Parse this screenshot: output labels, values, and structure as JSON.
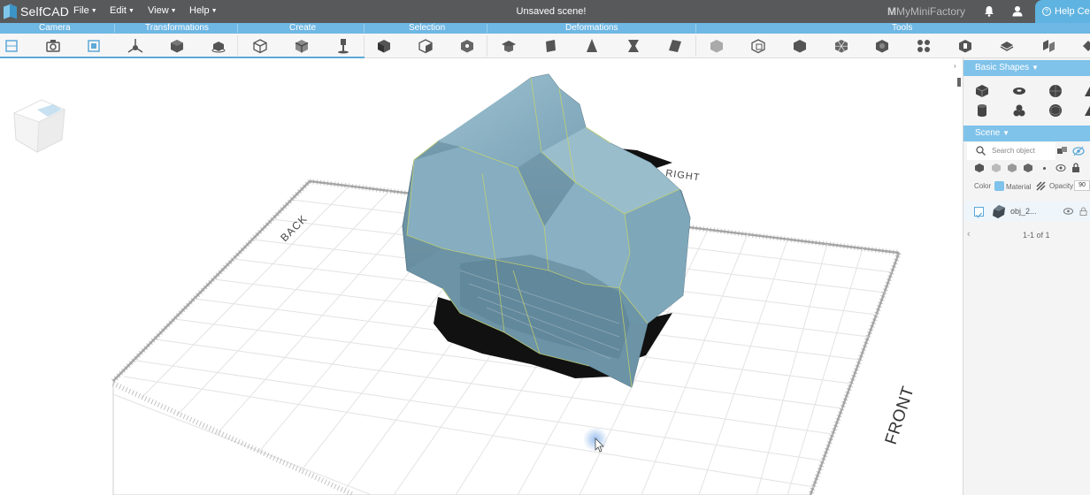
{
  "app": {
    "logo_text": "SelfCAD",
    "document_title": "Unsaved scene!",
    "brand": "MyMiniFactory",
    "help_label": "Help Center"
  },
  "menu": [
    {
      "label": "File"
    },
    {
      "label": "Edit"
    },
    {
      "label": "View"
    },
    {
      "label": "Help"
    }
  ],
  "sections": [
    "Camera",
    "Transformations",
    "Create",
    "Selection",
    "Deformations",
    "Tools"
  ],
  "toolbar_icons": [
    "camera-front-icon",
    "camera-snapshot-icon",
    "camera-focus-icon",
    "move-icon",
    "rotate-icon",
    "scale-icon",
    "create-box-icon",
    "create-sketch-icon",
    "create-pin-icon",
    "select-face-icon",
    "select-edge-icon",
    "select-vertex-icon",
    "deform-sculpt-icon",
    "deform-bend-icon",
    "deform-taper-icon",
    "deform-twist-icon",
    "deform-skew-icon",
    "tool-add-icon",
    "tool-subtract-icon",
    "tool-solid-icon",
    "tool-grid-icon",
    "tool-smooth-icon",
    "tool-array-icon",
    "tool-repair-icon",
    "tool-slice-icon",
    "tool-split-icon"
  ],
  "viewport": {
    "axis_labels": {
      "back": "BACK",
      "right": "RIGHT",
      "front": "FRONT"
    },
    "colors": {
      "mesh": "#7aa3b6",
      "mesh_dark": "#5f8597",
      "wire": "#c8d66a",
      "shadow": "#111111",
      "grid": "#d9d9d9"
    }
  },
  "panel": {
    "basic_shapes_title": "Basic Shapes",
    "shape_icons": [
      "cube-icon",
      "torus-icon",
      "sphere-icon",
      "cone-icon",
      "cylinder-icon",
      "blob-icon",
      "geosphere-icon",
      "pyramid-icon"
    ],
    "scene_title": "Scene",
    "search_placeholder": "Search object",
    "color_label": "Color",
    "material_label": "Material",
    "opacity_label": "Opacity",
    "opacity_value": "90",
    "object_name": "obj_2...",
    "pagination": "1-1 of 1",
    "accent": "#7fc2ea"
  }
}
